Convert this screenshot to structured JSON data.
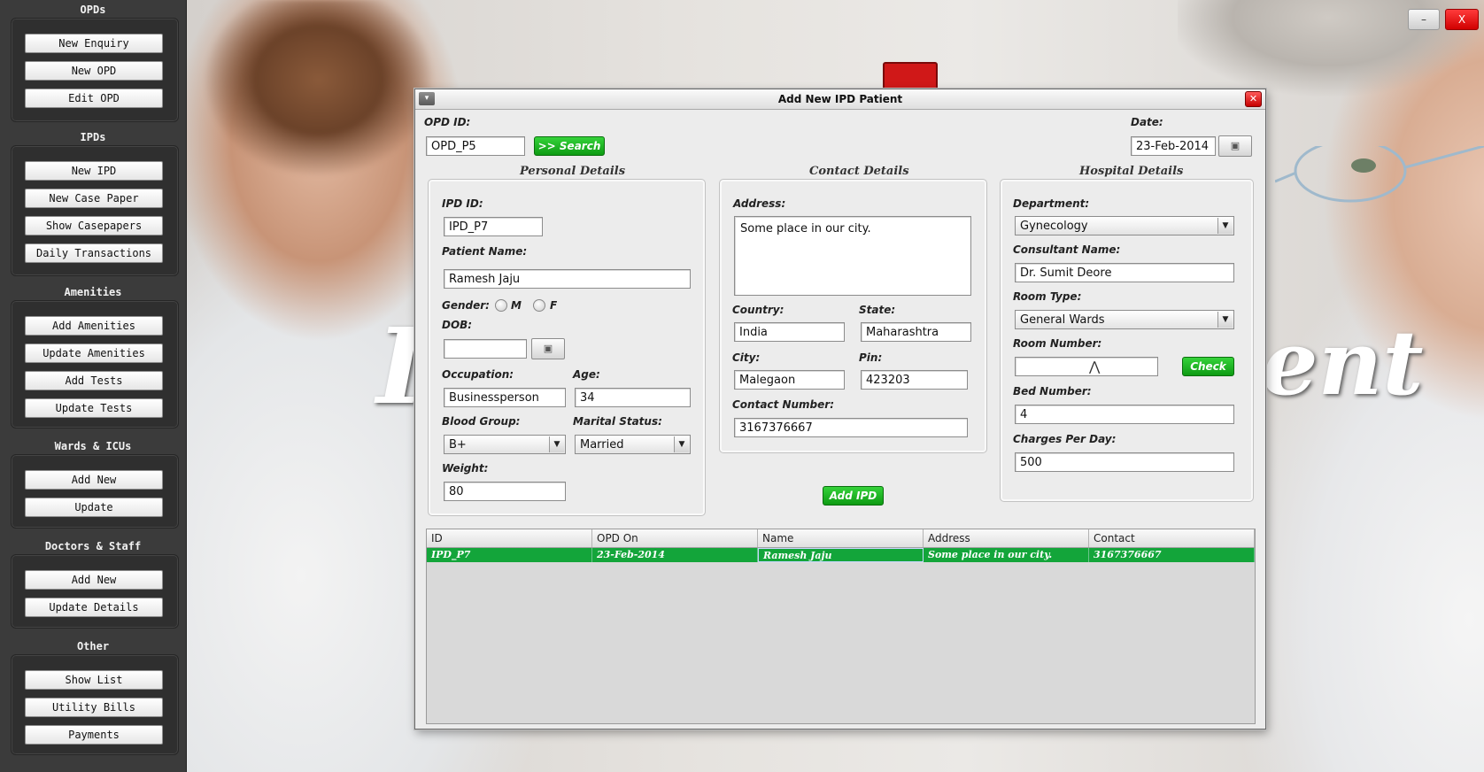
{
  "background": {
    "word_left": "I",
    "word_right": "ent"
  },
  "window_controls": {
    "minimize": "–",
    "close": "X"
  },
  "sidebar": {
    "groups": [
      {
        "title": "OPDs",
        "buttons": [
          "New Enquiry",
          "New OPD",
          "Edit OPD"
        ]
      },
      {
        "title": "IPDs",
        "buttons": [
          "New IPD",
          "New Case Paper",
          "Show Casepapers",
          "Daily Transactions"
        ]
      },
      {
        "title": "Amenities",
        "buttons": [
          "Add Amenities",
          "Update Amenities",
          "Add Tests",
          "Update Tests"
        ]
      },
      {
        "title": "Wards & ICUs",
        "buttons": [
          "Add New",
          "Update"
        ]
      },
      {
        "title": "Doctors & Staff",
        "buttons": [
          "Add New",
          "Update Details"
        ]
      },
      {
        "title": "Other",
        "buttons": [
          "Show List",
          "Utility Bills",
          "Payments"
        ]
      }
    ]
  },
  "dialog": {
    "title": "Add New IPD Patient",
    "menu_icon": "▾",
    "close_icon": "✕",
    "opd_id_label": "OPD ID:",
    "opd_id_value": "OPD_P5",
    "search_button": ">> Search",
    "date_label": "Date:",
    "date_value": "23-Feb-2014",
    "calendar_icon": "▣",
    "personal": {
      "heading": "Personal Details",
      "ipd_id_label": "IPD ID:",
      "ipd_id_value": "IPD_P7",
      "patient_name_label": "Patient Name:",
      "patient_name_value": "Ramesh Jaju",
      "gender_label": "Gender:",
      "gender_m": "M",
      "gender_f": "F",
      "dob_label": "DOB:",
      "dob_value": "",
      "occupation_label": "Occupation:",
      "occupation_value": "Businessperson",
      "age_label": "Age:",
      "age_value": "34",
      "blood_group_label": "Blood Group:",
      "blood_group_value": "B+",
      "marital_status_label": "Marital Status:",
      "marital_status_value": "Married",
      "weight_label": "Weight:",
      "weight_value": "80"
    },
    "contact": {
      "heading": "Contact Details",
      "address_label": "Address:",
      "address_value": "Some place in our city.",
      "country_label": "Country:",
      "country_value": "India",
      "state_label": "State:",
      "state_value": "Maharashtra",
      "city_label": "City:",
      "city_value": "Malegaon",
      "pin_label": "Pin:",
      "pin_value": "423203",
      "contact_number_label": "Contact Number:",
      "contact_number_value": "3167376667",
      "add_ipd_button": "Add IPD"
    },
    "hospital": {
      "heading": "Hospital Details",
      "department_label": "Department:",
      "department_value": "Gynecology",
      "consultant_label": "Consultant Name:",
      "consultant_value": "Dr. Sumit Deore",
      "room_type_label": "Room Type:",
      "room_type_value": "General Wards",
      "room_number_label": "Room Number:",
      "room_number_value": "",
      "check_button": "Check",
      "bed_number_label": "Bed Number:",
      "bed_number_value": "4",
      "charges_label": "Charges Per Day:",
      "charges_value": "500"
    },
    "table": {
      "columns": [
        "ID",
        "OPD On",
        "Name",
        "Address",
        "Contact"
      ],
      "rows": [
        [
          "IPD_P7",
          "23-Feb-2014",
          "Ramesh Jaju",
          "Some place in our city.",
          "3167376667"
        ]
      ],
      "selected_color": "#13a53a"
    }
  },
  "colors": {
    "accent_green": "#13a53a",
    "sidebar_bg": "#3b3b3b",
    "close_red": "#d10000"
  }
}
